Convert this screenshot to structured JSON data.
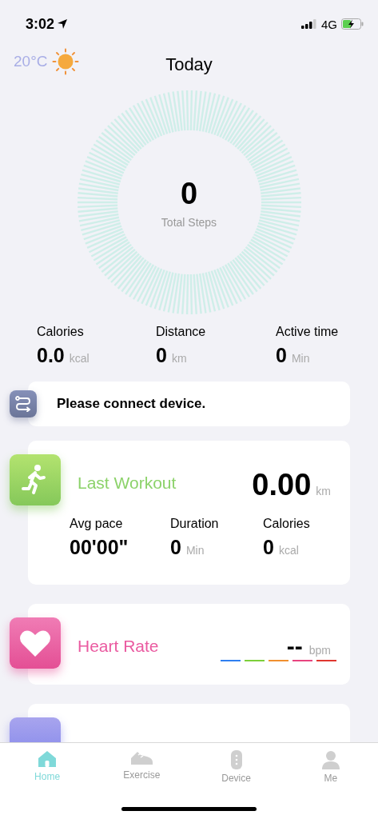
{
  "status_bar": {
    "time": "3:02",
    "network": "4G"
  },
  "header": {
    "temperature": "20°C",
    "title": "Today"
  },
  "steps": {
    "value": "0",
    "label": "Total Steps"
  },
  "stats": [
    {
      "label": "Calories",
      "value": "0.0",
      "unit": "kcal"
    },
    {
      "label": "Distance",
      "value": "0",
      "unit": "km"
    },
    {
      "label": "Active time",
      "value": "0",
      "unit": "Min"
    }
  ],
  "connect_banner": {
    "message": "Please connect device."
  },
  "last_workout": {
    "title": "Last Workout",
    "distance": "0.00",
    "unit": "km",
    "metrics": [
      {
        "label": "Avg pace",
        "value": "00'00\""
      },
      {
        "label": "Duration",
        "value": "0",
        "unit": "Min"
      },
      {
        "label": "Calories",
        "value": "0",
        "unit": "kcal"
      }
    ]
  },
  "heart_rate": {
    "title": "Heart Rate",
    "value": "--",
    "unit": "bpm",
    "zones": [
      {
        "color": "#2f7ff0"
      },
      {
        "color": "#7ccf3a"
      },
      {
        "color": "#f0902f"
      },
      {
        "color": "#e8447f"
      },
      {
        "color": "#e0362f"
      }
    ]
  },
  "tabs": [
    {
      "label": "Home",
      "kind": "home",
      "selected": true
    },
    {
      "label": "Exercise",
      "kind": "exercise",
      "selected": false
    },
    {
      "label": "Device",
      "kind": "device",
      "selected": false
    },
    {
      "label": "Me",
      "kind": "me",
      "selected": false
    }
  ]
}
